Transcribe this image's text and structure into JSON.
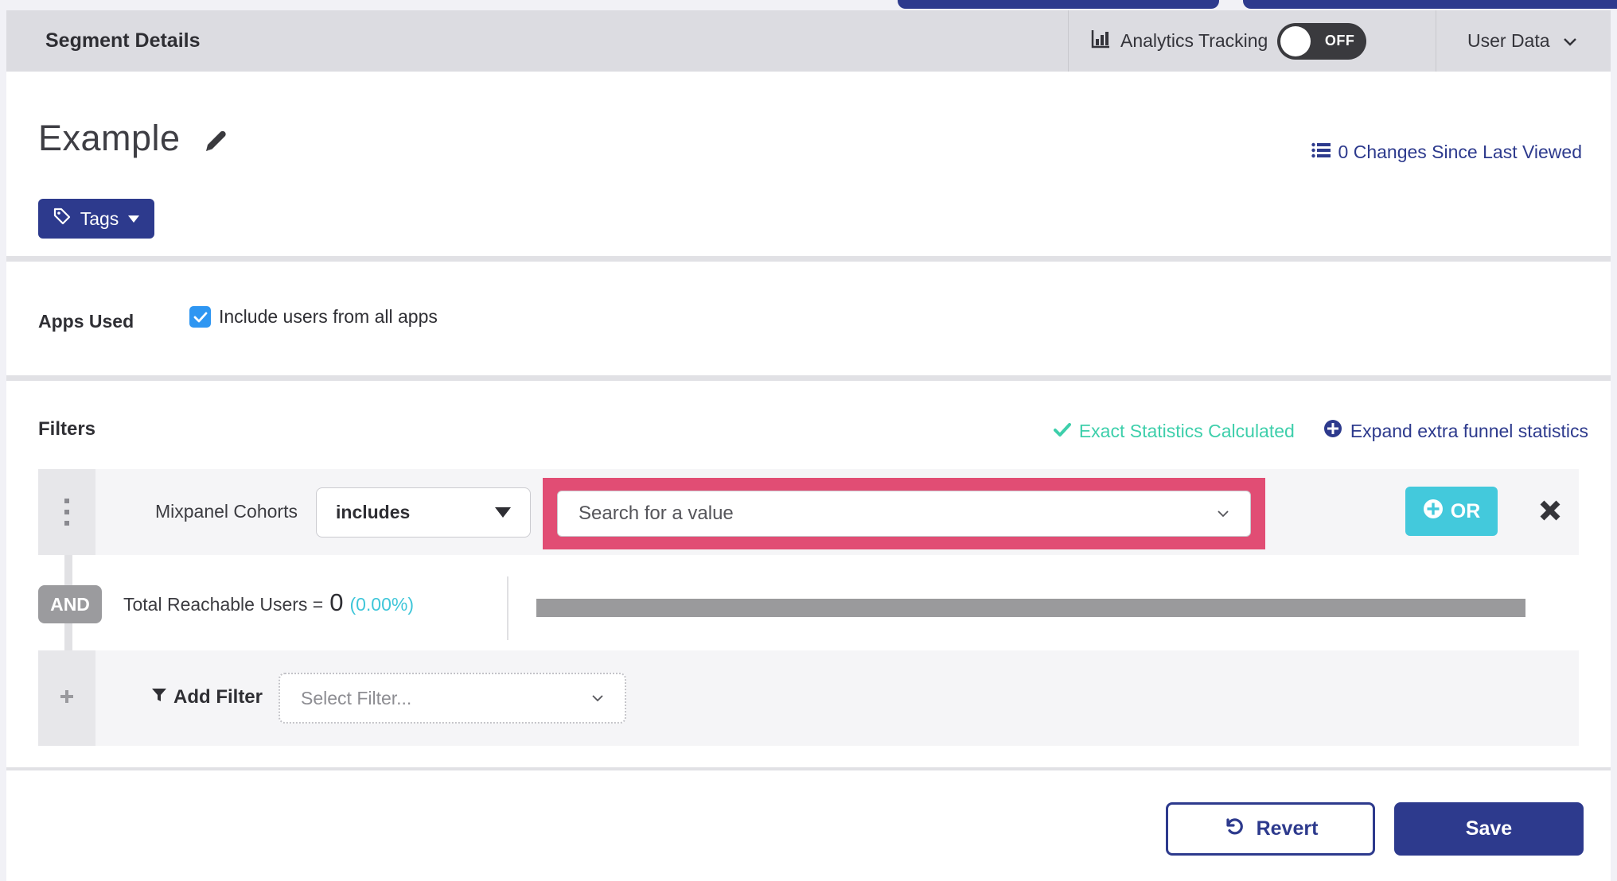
{
  "header": {
    "title": "Segment Details",
    "analytics_tracking": {
      "label": "Analytics Tracking",
      "state": "OFF"
    },
    "user_data": {
      "label": "User Data"
    }
  },
  "segment": {
    "name": "Example",
    "tags_button": "Tags",
    "changes_link": "0 Changes Since Last Viewed"
  },
  "apps_used": {
    "label": "Apps Used",
    "checkbox_label": "Include users from all apps",
    "checked": true
  },
  "filters": {
    "title": "Filters",
    "status": {
      "exact": "Exact Statistics Calculated",
      "expand": "Expand extra funnel statistics"
    },
    "row": {
      "field": "Mixpanel Cohorts",
      "operator": "includes",
      "value_placeholder": "Search for a value",
      "or_button": "OR"
    },
    "and_badge": "AND",
    "reachable": {
      "label": "Total Reachable Users =",
      "value": "0",
      "percent": "(0.00%)"
    },
    "add_filter": {
      "label": "Add Filter",
      "placeholder": "Select Filter..."
    }
  },
  "footer": {
    "revert": "Revert",
    "save": "Save"
  },
  "colors": {
    "navy": "#2d3a8d",
    "teal": "#3ecfab",
    "cyan": "#43c9dc",
    "highlight_pink": "#e14d74",
    "checkbox_blue": "#2e96f2",
    "bar_gray": "#9a9a9c"
  },
  "icons": {
    "edit": "pencil",
    "tags": "tag",
    "changes": "bullet-list",
    "analytics": "bar-chart",
    "toggle": "switch-off",
    "exact": "check",
    "expand": "plus-circle",
    "drag": "vertical-dots",
    "or": "plus-circle",
    "remove": "close-x",
    "add_filter": "funnel",
    "add_row": "plus",
    "revert": "undo-arrow",
    "dropdown_solid": "caret-down",
    "dropdown_thin": "chevron-down"
  }
}
